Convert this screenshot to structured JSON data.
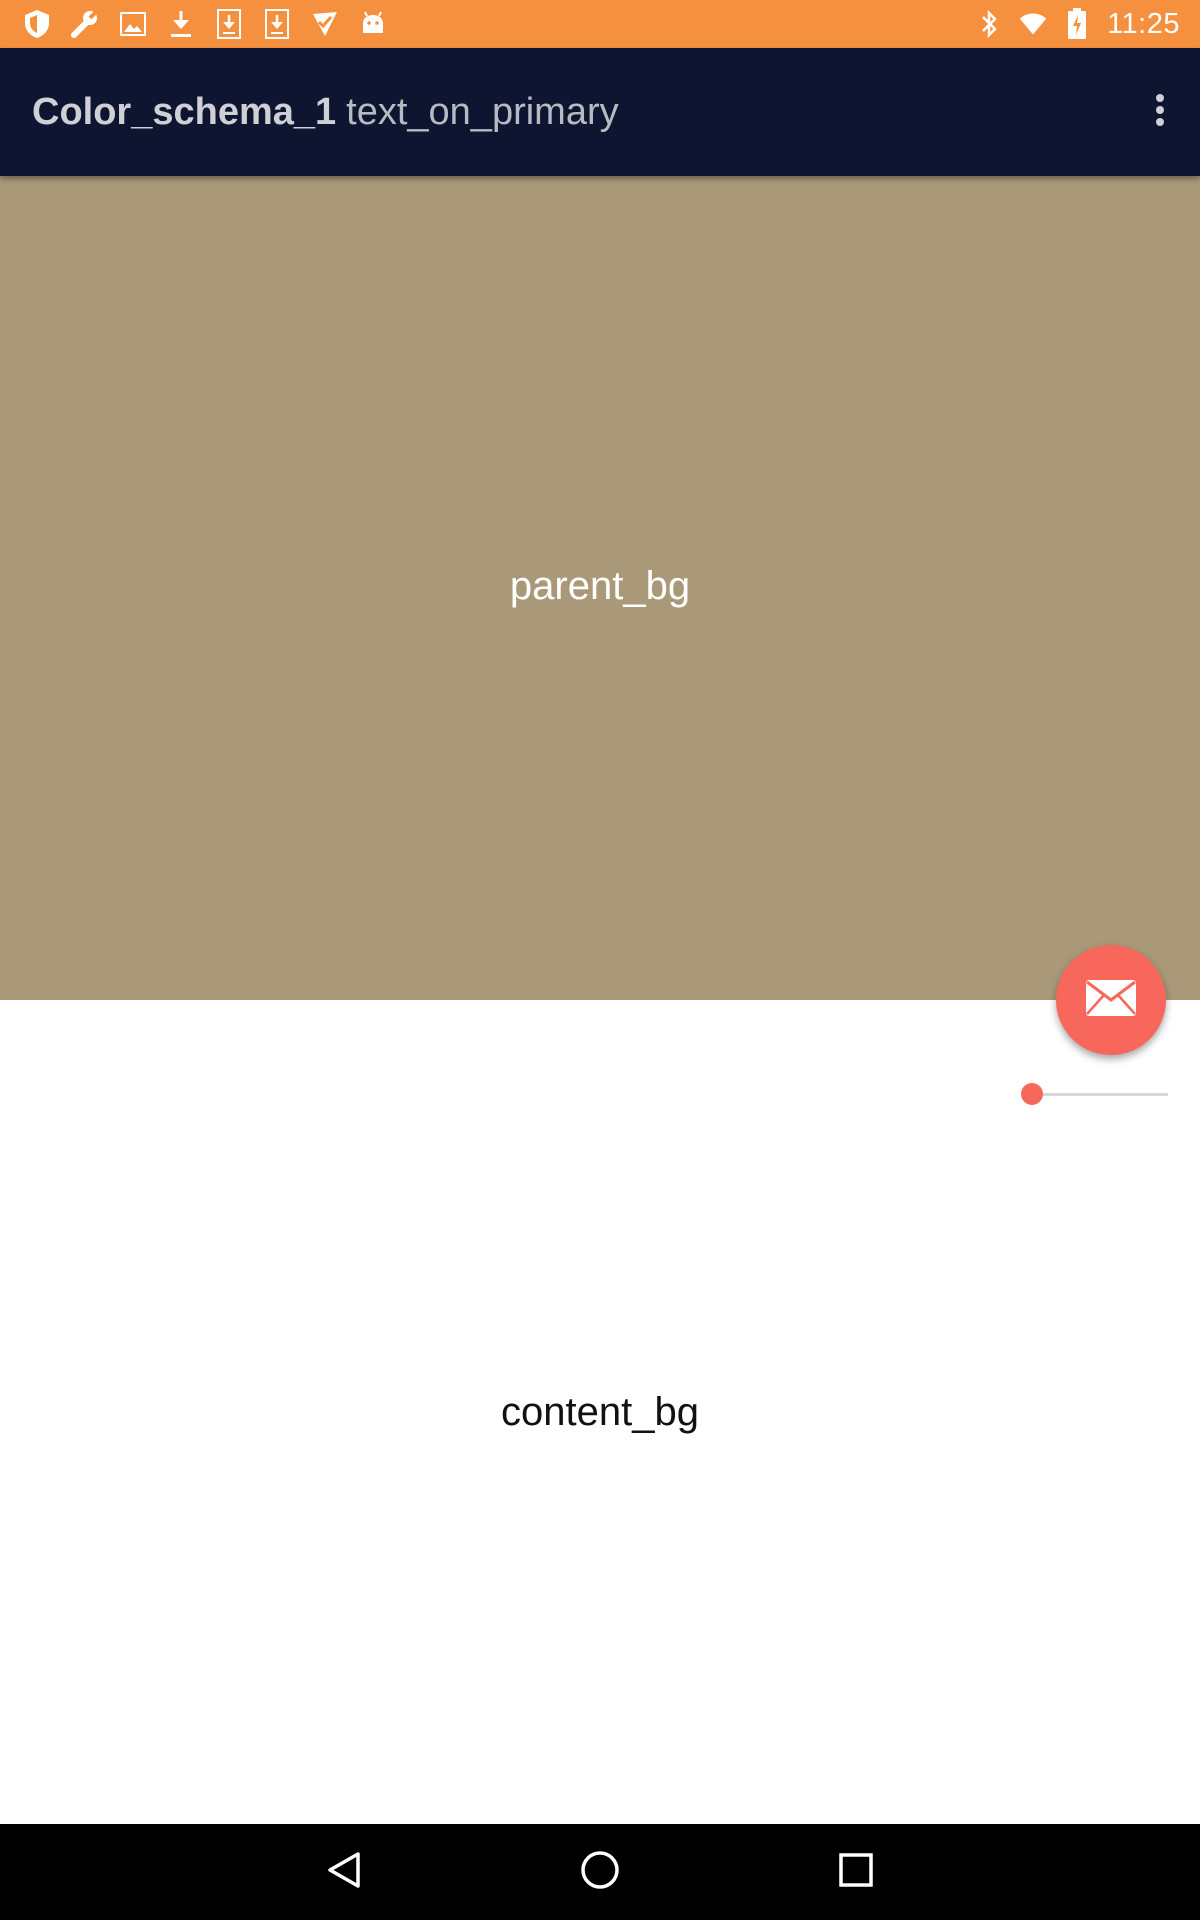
{
  "status_bar": {
    "background": "#F4903E",
    "left_icons": [
      "shield-icon",
      "wrench-icon",
      "image-icon",
      "download-icon",
      "download-box-icon",
      "download-box-icon",
      "check-flag-icon",
      "android-icon"
    ],
    "right_icons": [
      "bluetooth-icon",
      "wifi-icon",
      "battery-charging-icon"
    ],
    "time": "11:25"
  },
  "app_bar": {
    "background": "#0E1530",
    "title_primary": "Color_schema_1",
    "title_secondary": "text_on_primary",
    "overflow_icon": "more-vert-icon"
  },
  "parent_panel": {
    "label": "parent_bg",
    "background": "#A99979"
  },
  "content_panel": {
    "label": "content_bg",
    "background": "#FFFFFF"
  },
  "fab": {
    "icon": "mail-icon",
    "color": "#F8675B"
  },
  "slider": {
    "value": 0,
    "accent": "#F8675B"
  },
  "nav_bar": {
    "buttons": [
      "back-icon",
      "home-icon",
      "recents-icon"
    ]
  }
}
